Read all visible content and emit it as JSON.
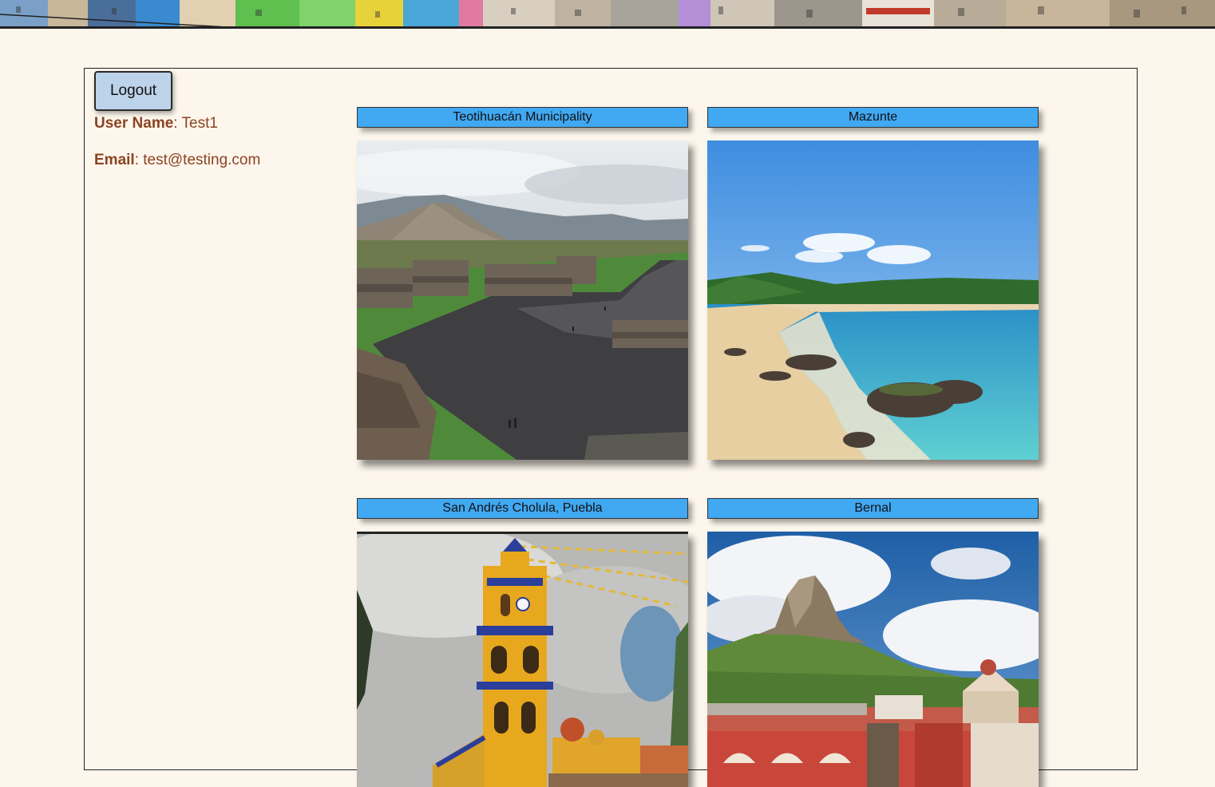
{
  "header": {
    "banner_icon": "colorful-houses-banner-image"
  },
  "user": {
    "logout_label": "Logout",
    "username_label": "User Name",
    "username_value": ": Test1",
    "email_label": "Email",
    "email_value": ": test@testing.com"
  },
  "destinations": [
    {
      "title": "Teotihuacán Municipality",
      "image": "pyramid-photo"
    },
    {
      "title": "Mazunte",
      "image": "beach-photo"
    },
    {
      "title": "San Andrés Cholula, Puebla",
      "image": "church-photo"
    },
    {
      "title": "Bernal",
      "image": "mountain-town-photo"
    }
  ],
  "colors": {
    "background": "#fdf6ec",
    "title_bar": "#41a8f2",
    "button": "#bcd3ea",
    "text_brown": "#8b4423"
  }
}
